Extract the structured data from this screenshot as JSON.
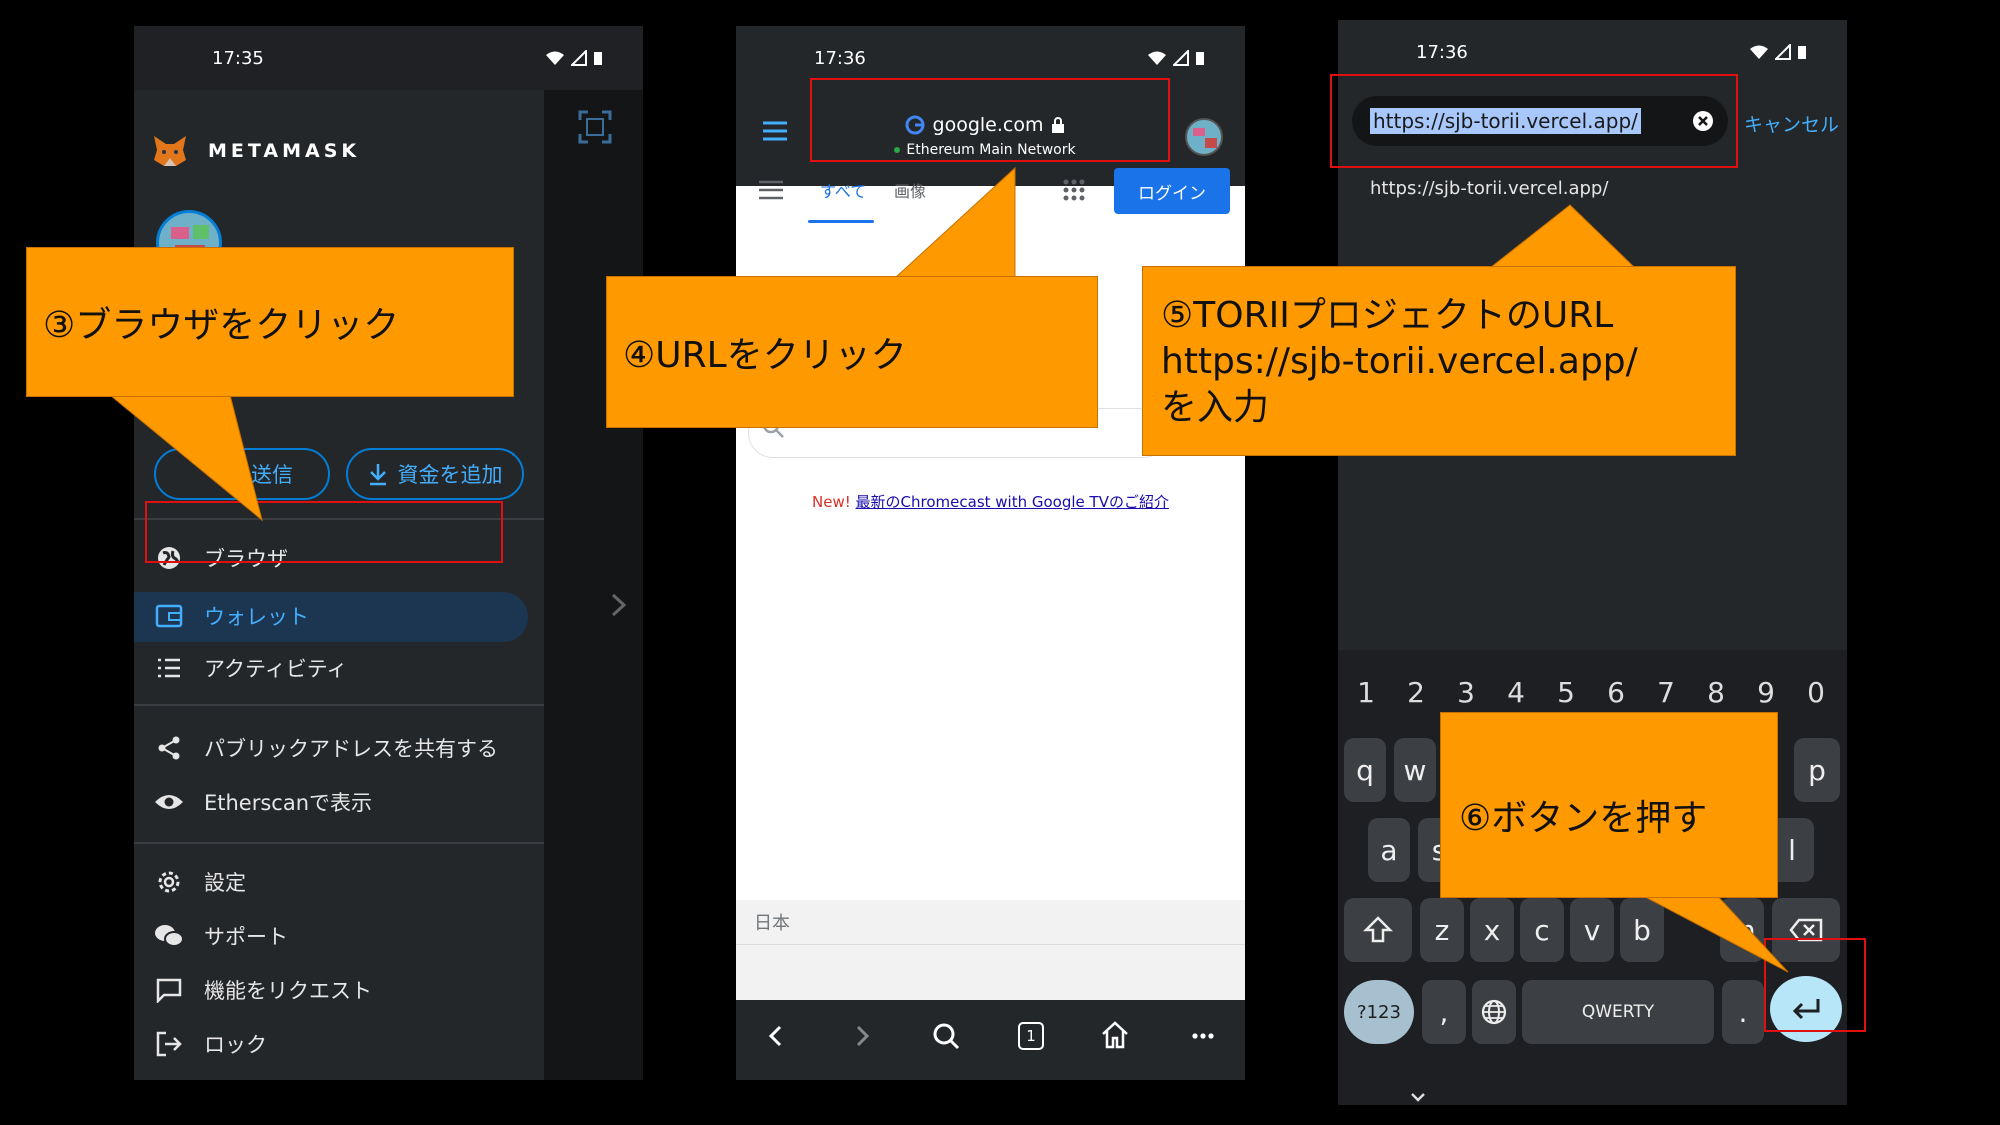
{
  "phone1": {
    "time": "17:35",
    "brand": "METAMASK",
    "send_label": "送信",
    "add_funds_label": "資金を追加",
    "menu": [
      {
        "label": "ブラウザ",
        "icon": "globe-icon"
      },
      {
        "label": "ウォレット",
        "icon": "wallet-icon"
      },
      {
        "label": "アクティビティ",
        "icon": "list-icon"
      },
      {
        "label": "パブリックアドレスを共有する",
        "icon": "share-icon"
      },
      {
        "label": "Etherscanで表示",
        "icon": "eye-icon"
      },
      {
        "label": "設定",
        "icon": "gear-icon"
      },
      {
        "label": "サポート",
        "icon": "chat-bubbles-icon"
      },
      {
        "label": "機能をリクエスト",
        "icon": "message-icon"
      },
      {
        "label": "ロック",
        "icon": "logout-icon"
      }
    ]
  },
  "phone2": {
    "time": "17:36",
    "url_domain": "google.com",
    "network": "Ethereum Main Network",
    "tabs": [
      "すべて",
      "画像"
    ],
    "login_label": "ログイン",
    "promo_new": "New!",
    "promo_link": "最新のChromecast with Google TVのご紹介",
    "region": "日本",
    "tab_count": "1"
  },
  "phone3": {
    "time": "17:36",
    "url_value": "https://sjb-torii.vercel.app/",
    "cancel_label": "キャンセル",
    "suggestion": "https://sjb-torii.vercel.app/",
    "number_row": [
      "1",
      "2",
      "3",
      "4",
      "5",
      "6",
      "7",
      "8",
      "9",
      "0"
    ],
    "keys": {
      "q": "q",
      "w": "w",
      "p": "p",
      "a": "a",
      "s": "s",
      "l": "l",
      "z": "z",
      "x": "x",
      "c": "c",
      "v": "v",
      "b": "b",
      "m": "m",
      "sym": "?123",
      "comma": ",",
      "space": "QWERTY",
      "period": "."
    }
  },
  "callouts": {
    "step3": "③ブラウザをクリック",
    "step4": "④URLをクリック",
    "step5_line1": "⑤TORIIプロジェクトのURL",
    "step5_line2": "https://sjb-torii.vercel.app/",
    "step5_line3": "を入力",
    "step6": "⑥ボタンを押す"
  },
  "colors": {
    "callout": "#ff9900",
    "highlight_box": "#e01010",
    "metamask_blue": "#037dd6",
    "google_blue": "#1a73e8"
  }
}
